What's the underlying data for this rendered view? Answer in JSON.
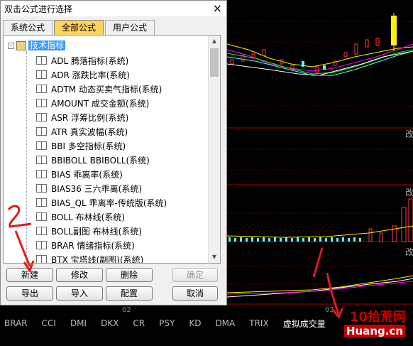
{
  "dialog": {
    "title": "双击公式进行选择",
    "close_glyph": "×",
    "tabs": [
      {
        "label": "系统公式",
        "active": false
      },
      {
        "label": "全部公式",
        "active": true
      },
      {
        "label": "用户公式",
        "active": false
      }
    ],
    "tree": {
      "expander": "-",
      "root_label": "技术指标",
      "items": [
        "ADL 腾落指标(系统)",
        "ADR 涨跌比率(系统)",
        "ADTM 动态买卖气指标(系统)",
        "AMOUNT 成交金额(系统)",
        "ASR 浮筹比例(系统)",
        "ATR 真实波幅(系统)",
        "BBI 多空指标(系统)",
        "BBIBOLL BBIBOLL(系统)",
        "BIAS 乖离率(系统)",
        "BIAS36 三六乖离(系统)",
        "BIAS_QL 乖离率-传统版(系统)",
        "BOLL 布林线(系统)",
        "BOLL副图 布林线(系统)",
        "BRAR 情绪指标(系统)",
        "BTX 宝塔线(副图)(系统)"
      ]
    },
    "buttons": {
      "new": "新建",
      "modify": "修改",
      "delete": "删除",
      "confirm": "确定",
      "export": "导出",
      "import": "导入",
      "config": "配置",
      "cancel": "取消"
    }
  },
  "indicator_bar": [
    "BRAR",
    "CCI",
    "DMI",
    "DKX",
    "CR",
    "PSY",
    "KD",
    "DMA",
    "TRIX",
    "虚拟成交量"
  ],
  "axis_labels": {
    "left": "02",
    "right": "03"
  },
  "right_labels": [
    "改",
    "改",
    "改"
  ],
  "annotation_number": "2",
  "watermark": {
    "logo_text": "10拾荒网",
    "domain_text": "Huang.cn"
  },
  "colors": {
    "tab_active": "#ffd35c",
    "tree_selected": "#3399ff",
    "annotation": "#e11b1b",
    "chart_red": "#ff3b3b",
    "chart_cyan": "#54ffff",
    "chart_yellow": "#fff200",
    "chart_green": "#00ff00",
    "chart_magenta": "#ff00ff"
  }
}
